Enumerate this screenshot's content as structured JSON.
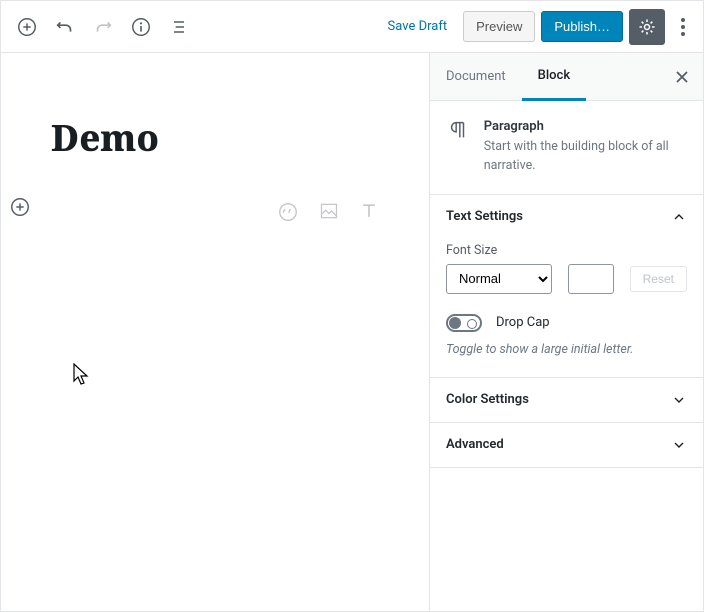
{
  "toolbar": {
    "save_draft": "Save Draft",
    "preview": "Preview",
    "publish": "Publish…"
  },
  "editor": {
    "title": "Demo"
  },
  "sidebar": {
    "tabs": {
      "document": "Document",
      "block": "Block"
    },
    "block_info": {
      "name": "Paragraph",
      "description": "Start with the building block of all narrative."
    },
    "text_settings": {
      "title": "Text Settings",
      "font_size_label": "Font Size",
      "font_size_value": "Normal",
      "reset": "Reset",
      "drop_cap_label": "Drop Cap",
      "drop_cap_help": "Toggle to show a large initial letter."
    },
    "color_settings_title": "Color Settings",
    "advanced_title": "Advanced"
  }
}
